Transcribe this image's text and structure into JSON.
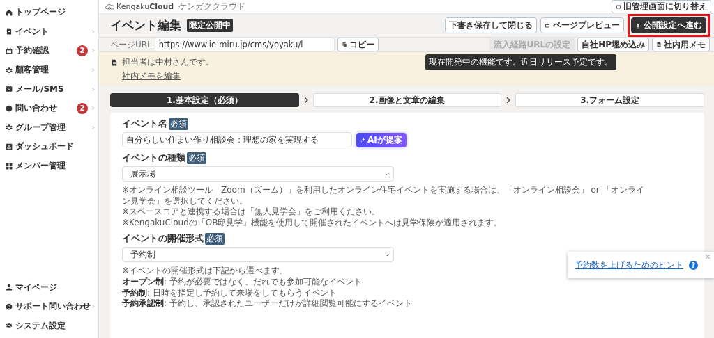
{
  "sidebar": {
    "items": [
      {
        "label": "トップページ",
        "has_submenu": false
      },
      {
        "label": "イベント",
        "has_submenu": true
      },
      {
        "label": "予約確認",
        "badge": "2",
        "has_submenu": true
      },
      {
        "label": "顧客管理",
        "has_submenu": true
      },
      {
        "label": "メール/SMS",
        "has_submenu": true
      },
      {
        "label": "問い合わせ",
        "badge": "2",
        "has_submenu": true
      },
      {
        "label": "グループ管理",
        "has_submenu": true
      },
      {
        "label": "ダッシュボード",
        "has_submenu": false
      },
      {
        "label": "メンバー管理",
        "has_submenu": false
      }
    ],
    "bottom_items": [
      {
        "label": "マイページ",
        "has_submenu": false
      },
      {
        "label": "サポート問い合わせ",
        "has_submenu": true
      },
      {
        "label": "システム設定",
        "has_submenu": false
      }
    ]
  },
  "topbar": {
    "logo": {
      "name_light": "Kengaku",
      "name_bold": "Cloud",
      "kana": "ケンガククラウド"
    },
    "switch_button": "旧管理画面に切り替え"
  },
  "header": {
    "title": "イベント編集",
    "status_badge": "限定公開中",
    "buttons": [
      {
        "label": "下書き保存して閉じる",
        "kind": "outline",
        "highlighted": false
      },
      {
        "label": "ページプレビュー",
        "kind": "outline-icon",
        "highlighted": false
      },
      {
        "label": "公開設定へ進む",
        "kind": "primary",
        "highlighted": true
      }
    ]
  },
  "url_bar": {
    "label": "ページURL",
    "value": "https://www.ie-miru.jp/cms/yoyaku/l",
    "copy_button": "コピー",
    "buttons": [
      {
        "label": "流入経路URLの設定",
        "disabled": true
      },
      {
        "label": "自社HP埋め込み",
        "disabled": false
      },
      {
        "label": "社内用メモ",
        "disabled": false
      }
    ],
    "tooltip": "現在開発中の機能です。近日リリース予定です。"
  },
  "memo": {
    "text": "担当者は中村さんです。",
    "edit_link": "社内メモを編集"
  },
  "steps": [
    {
      "label": "1.基本設定（必須）",
      "selected": true
    },
    {
      "label": "2.画像と文章の編集",
      "selected": false
    },
    {
      "label": "3.フォーム設定",
      "selected": false
    }
  ],
  "form": {
    "fields": [
      {
        "kind": "text",
        "label": "イベント名",
        "required_badge": "必須",
        "value": "自分らしい住まい作り相談会：理想の家を実現する",
        "ai_button": "AIが提案"
      },
      {
        "kind": "select",
        "label": "イベントの種類",
        "required_badge": "必須",
        "value": "展示場",
        "notes": [
          "※オンライン相談ツール「Zoom（ズーム）」を利用したオンライン住宅イベントを実施する場合は、「オンライン相談会」 or 「オンライン見学会」を選択してください。",
          "※スペースコアと連携する場合は「無人見学会」をご利用ください。",
          "※KengakuCloudの「OB邸見学」機能を使用して開催されたイベントへは見学保険が適用されます。"
        ]
      },
      {
        "kind": "select",
        "label": "イベントの開催形式",
        "required_badge": "必須",
        "value": "予約制",
        "notes": [
          "※イベントの開催形式は下記から選べます。",
          "**オープン制**: 予約が必要ではなく、だれでも参加可能なイベント",
          "**予約制**: 日時を指定し予約して来場をしてもらうイベント",
          "**予約承認制**: 予約し、承認されたユーザーだけが詳細閲覧可能にするイベント"
        ]
      }
    ]
  },
  "hint_popup": {
    "link": "予約数を上げるためのヒント",
    "help": "?",
    "close": "×"
  }
}
